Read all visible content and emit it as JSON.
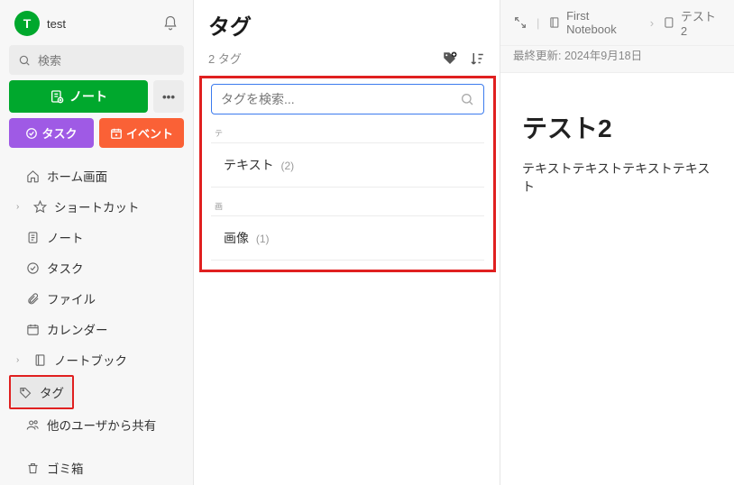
{
  "sidebar": {
    "user": {
      "initial": "T",
      "name": "test"
    },
    "search_placeholder": "検索",
    "new_note_label": "ノート",
    "task_button": "タスク",
    "event_button": "イベント",
    "nav": {
      "home": "ホーム画面",
      "shortcuts": "ショートカット",
      "notes": "ノート",
      "tasks": "タスク",
      "files": "ファイル",
      "calendar": "カレンダー",
      "notebooks": "ノートブック",
      "tags": "タグ",
      "shared": "他のユーザから共有",
      "trash": "ゴミ箱"
    }
  },
  "tags_panel": {
    "title": "タグ",
    "count_label": "2 タグ",
    "search_placeholder": "タグを検索...",
    "groups": [
      {
        "letter": "テ",
        "items": [
          {
            "name": "テキスト",
            "count": "(2)"
          }
        ]
      },
      {
        "letter": "画",
        "items": [
          {
            "name": "画像",
            "count": "(1)"
          }
        ]
      }
    ]
  },
  "note_panel": {
    "breadcrumb_notebook": "First Notebook",
    "breadcrumb_note": "テスト2",
    "last_updated": "最終更新: 2024年9月18日",
    "title": "テスト2",
    "body": "テキストテキストテキストテキスト"
  }
}
